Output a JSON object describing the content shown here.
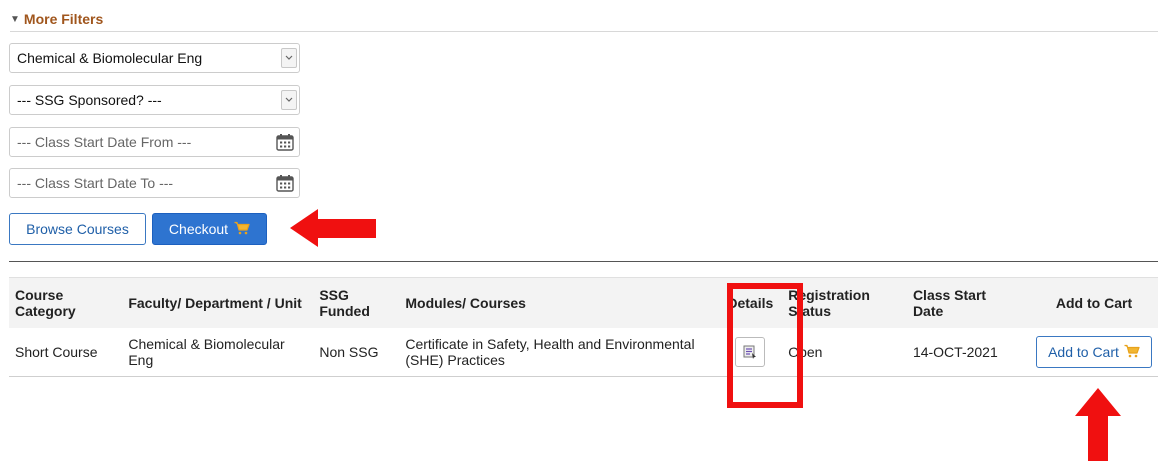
{
  "filters": {
    "toggle_label": "More Filters",
    "faculty_select": "Chemical & Biomolecular Eng",
    "ssg_select": "--- SSG Sponsored? ---",
    "start_from_placeholder": "--- Class Start Date From ---",
    "start_to_placeholder": "--- Class Start Date To ---"
  },
  "actions": {
    "browse_label": "Browse Courses",
    "checkout_label": "Checkout"
  },
  "table": {
    "headers": {
      "category": [
        "Course",
        "Category"
      ],
      "faculty": "Faculty/ Department / Unit",
      "ssg": [
        "SSG",
        "Funded"
      ],
      "modules": "Modules/ Courses",
      "details": "Details",
      "status": [
        "Registration",
        "Status"
      ],
      "start": [
        "Class Start",
        "Date"
      ],
      "cart": "Add to Cart"
    },
    "rows": [
      {
        "category": "Short Course",
        "faculty": "Chemical & Biomolecular Eng",
        "ssg": "Non SSG",
        "module": "Certificate in Safety, Health and Environmental (SHE) Practices",
        "status": "Open",
        "start_date": "14-OCT-2021",
        "cart_label": "Add to Cart"
      }
    ]
  },
  "colors": {
    "accent_orange": "#a0561d",
    "primary_blue": "#2e74d0",
    "annotation_red": "#f01010",
    "cart_icon": "#e8a21c"
  },
  "icons": [
    "triangle-down-icon",
    "chevron-down-icon",
    "calendar-icon",
    "cart-icon",
    "details-icon"
  ]
}
